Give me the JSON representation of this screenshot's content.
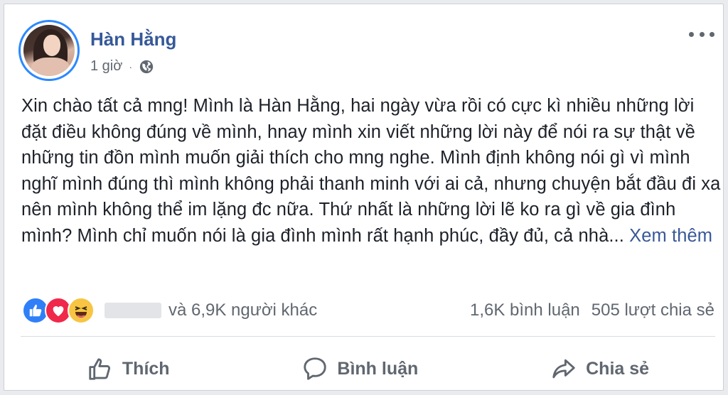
{
  "post": {
    "author": "Hàn Hằng",
    "time": "1 giờ",
    "separator": "·",
    "text": "Xin chào tất cả mng! Mình là Hàn Hằng, hai ngày vừa rồi có cực kì nhiều những lời đặt điều không đúng về mình, hnay mình xin viết những lời này để nói ra sự thật về những tin đồn mình muốn giải thích cho mng nghe. Mình định không nói gì vì mình nghĩ mình đúng thì mình không phải thanh minh với ai cả, nhưng chuyện bắt đầu đi xa nên mình không thể im lặng đc nữa. Thứ nhất là những lời lẽ ko ra gì về gia đình mình? Mình chỉ muốn nói là gia đình mình rất hạnh phúc, đầy đủ, cả nhà...",
    "see_more": "Xem thêm"
  },
  "reactions": {
    "icons": [
      "like-icon",
      "love-icon",
      "haha-icon"
    ],
    "others_text": "và 6,9K người khác",
    "comments": "1,6K bình luận",
    "shares": "505 lượt chia sẻ"
  },
  "actions": {
    "like": "Thích",
    "comment": "Bình luận",
    "share": "Chia sẻ"
  },
  "colors": {
    "author": "#365899",
    "link": "#385898",
    "avatar_ring": "#2d88ff",
    "like": "#2f7ff8",
    "love": "#f0284a",
    "haha": "#f7c543"
  }
}
